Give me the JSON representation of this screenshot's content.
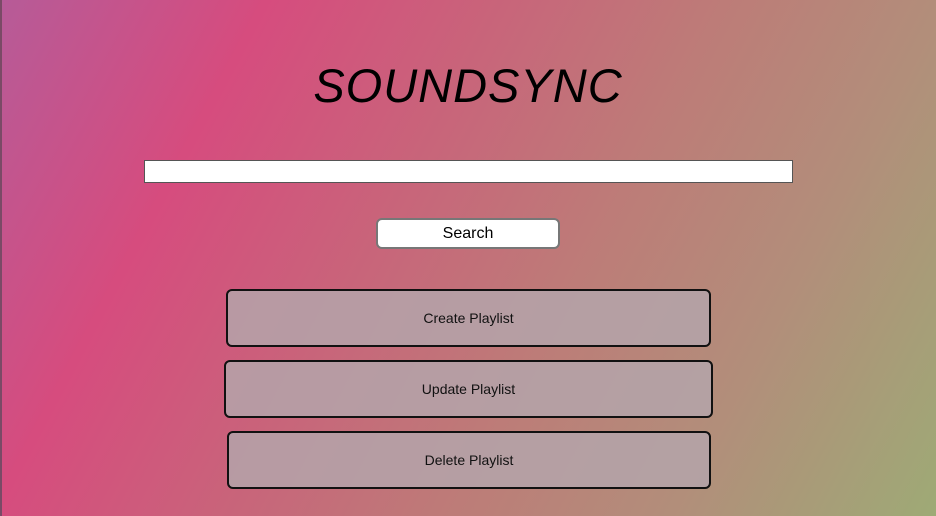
{
  "header": {
    "title": "SOUNDSYNC"
  },
  "search": {
    "value": "",
    "placeholder": "",
    "button_label": "Search"
  },
  "actions": {
    "create_label": "Create Playlist",
    "update_label": "Update Playlist",
    "delete_label": "Delete Playlist"
  }
}
